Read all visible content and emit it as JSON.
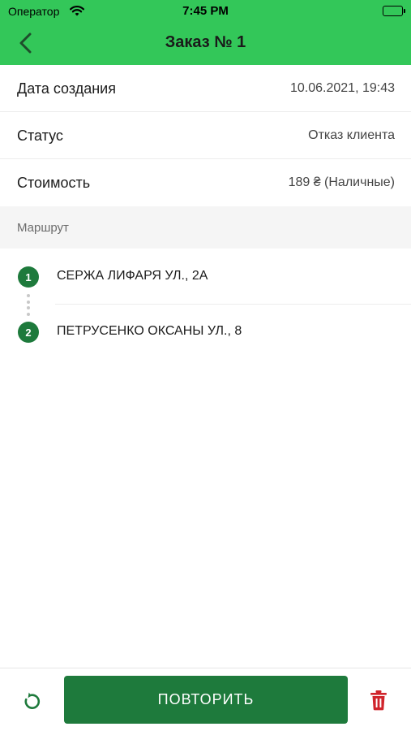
{
  "status_bar": {
    "carrier": "Оператор",
    "time": "7:45 PM",
    "icons": [
      "wifi-icon",
      "battery-icon"
    ]
  },
  "header": {
    "title": "Заказ № 1",
    "back_icon": "chevron-left-icon",
    "background_color": "#33c759"
  },
  "details": [
    {
      "label": "Дата создания",
      "value": "10.06.2021, 19:43"
    },
    {
      "label": "Статус",
      "value": "Отказ клиента"
    },
    {
      "label": "Стоимость",
      "value": "189 ₴ (Наличные)"
    }
  ],
  "route": {
    "section_label": "Маршрут",
    "points": [
      {
        "number": "1",
        "address": "СЕРЖА ЛИФАРЯ УЛ., 2А"
      },
      {
        "number": "2",
        "address": "ПЕТРУСЕНКО ОКСАНЫ УЛ., 8"
      }
    ]
  },
  "footer": {
    "repeat_label": "ПОВТОРИТЬ",
    "refresh_icon": "refresh-icon",
    "delete_icon": "trash-icon",
    "accent_color": "#1e7a3c",
    "delete_color": "#d0242b"
  }
}
